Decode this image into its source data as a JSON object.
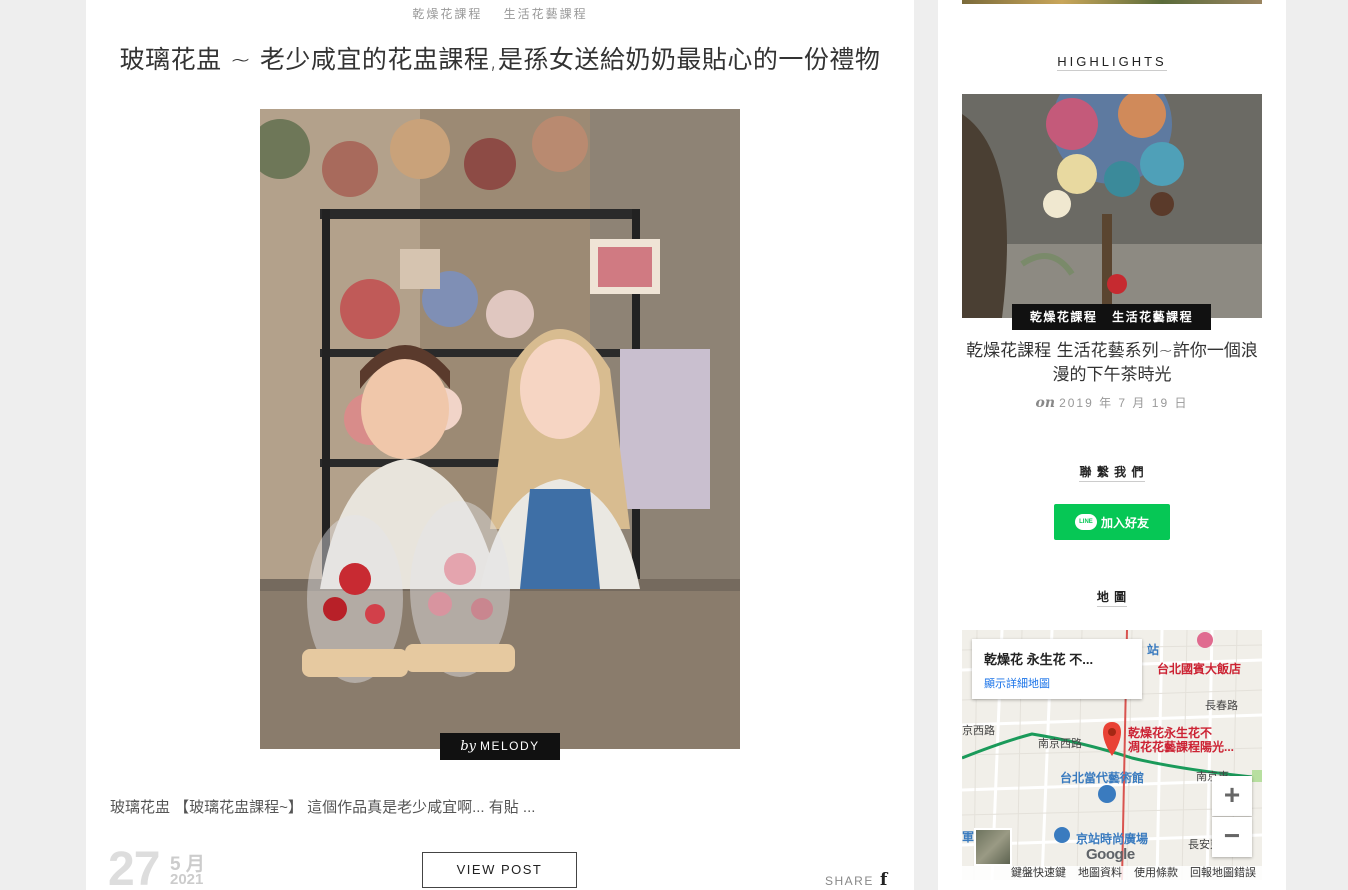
{
  "post": {
    "categories": [
      "乾燥花課程",
      "生活花藝課程"
    ],
    "title": "玻璃花盅 ~ 老少咸宜的花盅課程,是孫女送給奶奶最貼心的一份禮物",
    "author_prefix": "by",
    "author": "MELODY",
    "excerpt": "玻璃花盅 【玻璃花盅課程~】 這個作品真是老少咸宜啊... 有貼 ...",
    "date": {
      "day": "27",
      "month": "5 月",
      "year": "2021"
    },
    "view_post_label": "VIEW POST",
    "share_label": "SHARE",
    "share_icon": "facebook-icon"
  },
  "sidebar": {
    "highlights_title": "HIGHLIGHTS",
    "highlight": {
      "categories": [
        "乾燥花課程",
        "生活花藝課程"
      ],
      "title": "乾燥花課程 生活花藝系列~許你一個浪漫的下午茶時光",
      "date_prefix": "on",
      "date": "2019 年 7 月 19 日"
    },
    "contact_title": "聯 繫 我 們",
    "line_button": {
      "logo": "LINE",
      "label": "加入好友"
    },
    "map_title": "地 圖",
    "map": {
      "info_name": "乾燥花 永生花 不...",
      "info_link": "顯示詳細地圖",
      "labels": {
        "station": "站",
        "hotel": "台北國賓大飯店",
        "changchun": "長春路",
        "pin_label_1": "乾燥花永生花不",
        "pin_label_2": "凋花花藝課程陽光...",
        "jing_road": "京西路",
        "nanjing_west": "南京西路",
        "nanjing_east": "南京東",
        "moca": "台北當代藝術館",
        "mall": "京站時尚廣場",
        "changan": "長安東",
        "jun": "軍"
      },
      "zoom_in": "+",
      "zoom_out": "−",
      "google": "Google",
      "footer": [
        "鍵盤快速鍵",
        "地圖資料",
        "使用條款",
        "回報地圖錯誤"
      ]
    }
  }
}
